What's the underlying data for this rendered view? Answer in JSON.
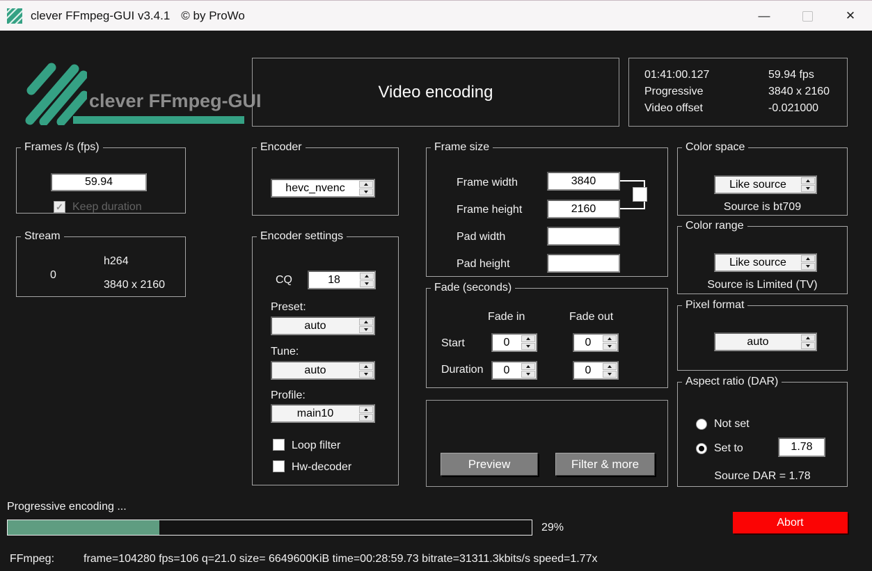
{
  "window": {
    "title": "clever FFmpeg-GUI v3.4.1",
    "copyright": "© by ProWo",
    "minimize_glyph": "—",
    "close_glyph": "✕"
  },
  "header": {
    "logo_text": "clever FFmpeg-GUI",
    "page_title": "Video encoding",
    "info": {
      "rows": [
        {
          "left": "01:41:00.127",
          "right": "59.94 fps"
        },
        {
          "left": "Progressive",
          "right": "3840 x 2160"
        },
        {
          "left": "Video offset",
          "right": "-0.021000"
        }
      ]
    }
  },
  "fps_group": {
    "title": "Frames /s (fps)",
    "value": "59.94",
    "keep_duration_label": "Keep duration"
  },
  "stream_group": {
    "title": "Stream",
    "index": "0",
    "codec": "h264",
    "resolution": "3840 x 2160"
  },
  "encoder_group": {
    "title": "Encoder",
    "value": "hevc_nvenc"
  },
  "encoder_settings": {
    "title": "Encoder settings",
    "cq_label": "CQ",
    "cq_value": "18",
    "preset_label": "Preset:",
    "preset_value": "auto",
    "tune_label": "Tune:",
    "tune_value": "auto",
    "profile_label": "Profile:",
    "profile_value": "main10",
    "loop_filter_label": "Loop filter",
    "hw_decoder_label": "Hw-decoder"
  },
  "frame_size": {
    "title": "Frame size",
    "fields": [
      {
        "label": "Frame width",
        "value": "3840"
      },
      {
        "label": "Frame height",
        "value": "2160"
      },
      {
        "label": "Pad width",
        "value": ""
      },
      {
        "label": "Pad height",
        "value": ""
      }
    ]
  },
  "fade": {
    "title": "Fade (seconds)",
    "col_in": "Fade in",
    "col_out": "Fade out",
    "start_label": "Start",
    "duration_label": "Duration",
    "start_in": "0",
    "start_out": "0",
    "duration_in": "0",
    "duration_out": "0"
  },
  "actions": {
    "preview": "Preview",
    "filter_more": "Filter & more"
  },
  "color_space": {
    "title": "Color space",
    "value": "Like source",
    "note": "Source is bt709"
  },
  "color_range": {
    "title": "Color range",
    "value": "Like source",
    "note": "Source is Limited (TV)"
  },
  "pixel_format": {
    "title": "Pixel format",
    "value": "auto"
  },
  "aspect_ratio": {
    "title": "Aspect ratio (DAR)",
    "not_set_label": "Not set",
    "set_to_label": "Set to",
    "value": "1.78",
    "note": "Source DAR = 1.78"
  },
  "progress": {
    "label": "Progressive encoding ...",
    "percent": 29,
    "percent_label": "29%",
    "abort_label": "Abort"
  },
  "status": {
    "prefix": "FFmpeg:",
    "text": "frame=104280 fps=106 q=21.0 size= 6649600KiB time=00:28:59.73 bitrate=31311.3kbits/s speed=1.77x"
  },
  "colors": {
    "accent_teal": "#35a184",
    "progress_fill": "#5f9d81",
    "abort_red": "#fb0404"
  }
}
